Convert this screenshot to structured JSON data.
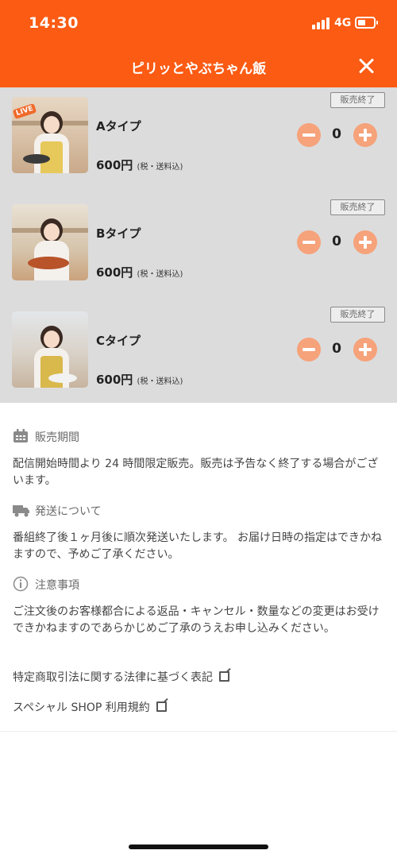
{
  "status_bar": {
    "time": "14:30",
    "network": "4G",
    "battery_level": 0.4
  },
  "header": {
    "title": "ピリッとやぶちゃん飯",
    "accent": "#fb5b13"
  },
  "products": [
    {
      "name": "Aタイプ",
      "price": "600円",
      "tax_note": "(税・送料込)",
      "badge": "販売終了",
      "qty": "0",
      "live_tag": "LIVE"
    },
    {
      "name": "Bタイプ",
      "price": "600円",
      "tax_note": "(税・送料込)",
      "badge": "販売終了",
      "qty": "0",
      "live_tag": ""
    },
    {
      "name": "Cタイプ",
      "price": "600円",
      "tax_note": "(税・送料込)",
      "badge": "販売終了",
      "qty": "0",
      "live_tag": ""
    }
  ],
  "sections": [
    {
      "icon": "calendar-icon",
      "title": "販売期間",
      "text": "配信開始時間より 24 時間限定販売。販売は予告なく終了する場合がございます。"
    },
    {
      "icon": "truck-icon",
      "title": "発送について",
      "text": "番組終了後１ヶ月後に順次発送いたします。 お届け日時の指定はできかねますので、予めご了承ください。"
    },
    {
      "icon": "info-icon",
      "title": "注意事項",
      "text": "ご注文後のお客様都合による返品・キャンセル・数量などの変更はお受けできかねますのであらかじめご了承のうえお申し込みください。"
    }
  ],
  "links": [
    {
      "label": "特定商取引法に関する法律に基づく表記",
      "icon": "external-link-icon"
    },
    {
      "label": "スペシャル SHOP 利用規約",
      "icon": "external-link-icon"
    }
  ]
}
